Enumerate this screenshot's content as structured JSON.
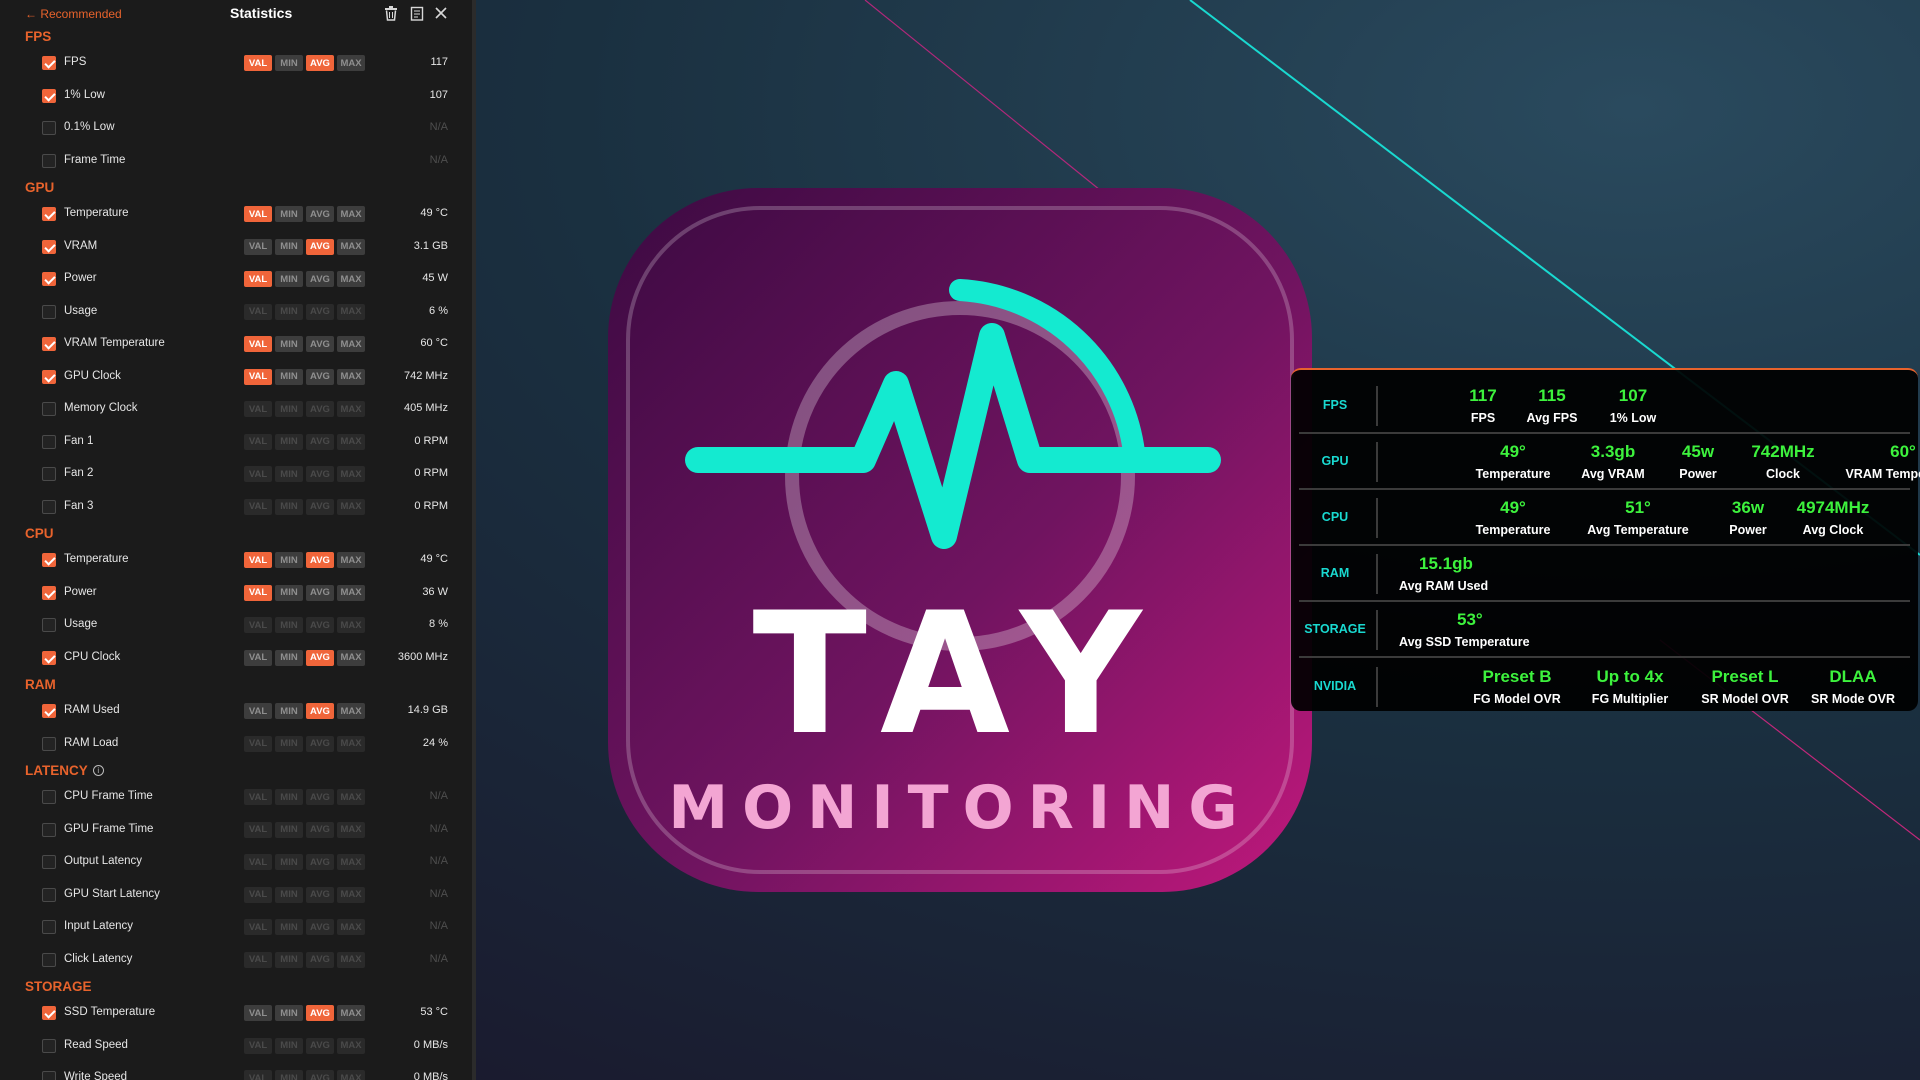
{
  "colors": {
    "accent": "#f0653a",
    "overlay_label": "#19d9d0",
    "overlay_value": "#3df23d",
    "logo_pulse": "#14ead0",
    "logo_bg_dark": "#3c0a42",
    "logo_bg_light": "#c0187c"
  },
  "panel": {
    "back_link": "← Recommended",
    "title": "Statistics",
    "icons": [
      "trash-icon",
      "clipboard-icon",
      "close-icon"
    ],
    "pill_labels": [
      "VAL",
      "MIN",
      "AVG",
      "MAX"
    ]
  },
  "sections": [
    {
      "title": "FPS",
      "rows": [
        {
          "label": "FPS",
          "checked": true,
          "value": "117",
          "pills": [
            "on",
            "off",
            "on",
            "off"
          ]
        },
        {
          "label": "1% Low",
          "checked": true,
          "value": "107",
          "pills": null
        },
        {
          "label": "0.1% Low",
          "checked": false,
          "value": "N/A",
          "pills": null
        },
        {
          "label": "Frame Time",
          "checked": false,
          "value": "N/A",
          "pills": null
        }
      ]
    },
    {
      "title": "GPU",
      "rows": [
        {
          "label": "Temperature",
          "checked": true,
          "value": "49 °C",
          "pills": [
            "on",
            "off",
            "off",
            "off"
          ]
        },
        {
          "label": "VRAM",
          "checked": true,
          "value": "3.1 GB",
          "pills": [
            "off",
            "off",
            "on",
            "off"
          ]
        },
        {
          "label": "Power",
          "checked": true,
          "value": "45 W",
          "pills": [
            "on",
            "off",
            "off",
            "off"
          ]
        },
        {
          "label": "Usage",
          "checked": false,
          "value": "6 %",
          "pills": [
            "dim",
            "dim",
            "dim",
            "dim"
          ]
        },
        {
          "label": "VRAM Temperature",
          "checked": true,
          "value": "60 °C",
          "pills": [
            "on",
            "off",
            "off",
            "off"
          ]
        },
        {
          "label": "GPU Clock",
          "checked": true,
          "value": "742 MHz",
          "pills": [
            "on",
            "off",
            "off",
            "off"
          ]
        },
        {
          "label": "Memory Clock",
          "checked": false,
          "value": "405 MHz",
          "pills": [
            "dim",
            "dim",
            "dim",
            "dim"
          ]
        },
        {
          "label": "Fan 1",
          "checked": false,
          "value": "0 RPM",
          "pills": [
            "dim",
            "dim",
            "dim",
            "dim"
          ]
        },
        {
          "label": "Fan 2",
          "checked": false,
          "value": "0 RPM",
          "pills": [
            "dim",
            "dim",
            "dim",
            "dim"
          ]
        },
        {
          "label": "Fan 3",
          "checked": false,
          "value": "0 RPM",
          "pills": [
            "dim",
            "dim",
            "dim",
            "dim"
          ]
        }
      ]
    },
    {
      "title": "CPU",
      "rows": [
        {
          "label": "Temperature",
          "checked": true,
          "value": "49 °C",
          "pills": [
            "on",
            "off",
            "on",
            "off"
          ]
        },
        {
          "label": "Power",
          "checked": true,
          "value": "36 W",
          "pills": [
            "on",
            "off",
            "off",
            "off"
          ]
        },
        {
          "label": "Usage",
          "checked": false,
          "value": "8 %",
          "pills": [
            "dim",
            "dim",
            "dim",
            "dim"
          ]
        },
        {
          "label": "CPU Clock",
          "checked": true,
          "value": "3600 MHz",
          "pills": [
            "off",
            "off",
            "on",
            "off"
          ]
        }
      ]
    },
    {
      "title": "RAM",
      "rows": [
        {
          "label": "RAM Used",
          "checked": true,
          "value": "14.9 GB",
          "pills": [
            "off",
            "off",
            "on",
            "off"
          ]
        },
        {
          "label": "RAM Load",
          "checked": false,
          "value": "24 %",
          "pills": [
            "dim",
            "dim",
            "dim",
            "dim"
          ]
        }
      ]
    },
    {
      "title": "LATENCY",
      "info": true,
      "rows": [
        {
          "label": "CPU Frame Time",
          "checked": false,
          "value": "N/A",
          "pills": [
            "dim",
            "dim",
            "dim",
            "dim"
          ]
        },
        {
          "label": "GPU Frame Time",
          "checked": false,
          "value": "N/A",
          "pills": [
            "dim",
            "dim",
            "dim",
            "dim"
          ]
        },
        {
          "label": "Output Latency",
          "checked": false,
          "value": "N/A",
          "pills": [
            "dim",
            "dim",
            "dim",
            "dim"
          ]
        },
        {
          "label": "GPU Start Latency",
          "checked": false,
          "value": "N/A",
          "pills": [
            "dim",
            "dim",
            "dim",
            "dim"
          ]
        },
        {
          "label": "Input Latency",
          "checked": false,
          "value": "N/A",
          "pills": [
            "dim",
            "dim",
            "dim",
            "dim"
          ]
        },
        {
          "label": "Click Latency",
          "checked": false,
          "value": "N/A",
          "pills": [
            "dim",
            "dim",
            "dim",
            "dim"
          ]
        }
      ]
    },
    {
      "title": "STORAGE",
      "rows": [
        {
          "label": "SSD Temperature",
          "checked": true,
          "value": "53 °C",
          "pills": [
            "off",
            "off",
            "on",
            "off"
          ]
        },
        {
          "label": "Read Speed",
          "checked": false,
          "value": "0 MB/s",
          "pills": [
            "dim",
            "dim",
            "dim",
            "dim"
          ]
        },
        {
          "label": "Write Speed",
          "checked": false,
          "value": "0 MB/s",
          "pills": [
            "dim",
            "dim",
            "dim",
            "dim"
          ]
        }
      ]
    }
  ],
  "logo": {
    "title": "TAY",
    "subtitle": "MONITORING"
  },
  "overlay": [
    {
      "category": "FPS",
      "metrics": [
        {
          "value": "117",
          "label": "FPS"
        },
        {
          "value": "115",
          "label": "Avg FPS"
        },
        {
          "value": "107",
          "label": "1% Low"
        }
      ]
    },
    {
      "category": "GPU",
      "metrics": [
        {
          "value": "49°",
          "label": "Temperature"
        },
        {
          "value": "3.3gb",
          "label": "Avg VRAM"
        },
        {
          "value": "45w",
          "label": "Power"
        },
        {
          "value": "742MHz",
          "label": "Clock"
        },
        {
          "value": "60°",
          "label": "VRAM Temperature"
        }
      ]
    },
    {
      "category": "CPU",
      "metrics": [
        {
          "value": "49°",
          "label": "Temperature"
        },
        {
          "value": "51°",
          "label": "Avg Temperature"
        },
        {
          "value": "36w",
          "label": "Power"
        },
        {
          "value": "4974MHz",
          "label": "Avg Clock"
        }
      ]
    },
    {
      "category": "RAM",
      "metrics": [
        {
          "value": "15.1gb",
          "label": "Avg RAM Used"
        }
      ]
    },
    {
      "category": "STORAGE",
      "metrics": [
        {
          "value": "53°",
          "label": "Avg SSD Temperature"
        }
      ]
    },
    {
      "category": "NVIDIA",
      "metrics": [
        {
          "value": "Preset B",
          "label": "FG Model OVR"
        },
        {
          "value": "Up to 4x",
          "label": "FG Multiplier"
        },
        {
          "value": "Preset L",
          "label": "SR Model OVR"
        },
        {
          "value": "DLAA",
          "label": "SR Mode OVR"
        }
      ]
    }
  ]
}
